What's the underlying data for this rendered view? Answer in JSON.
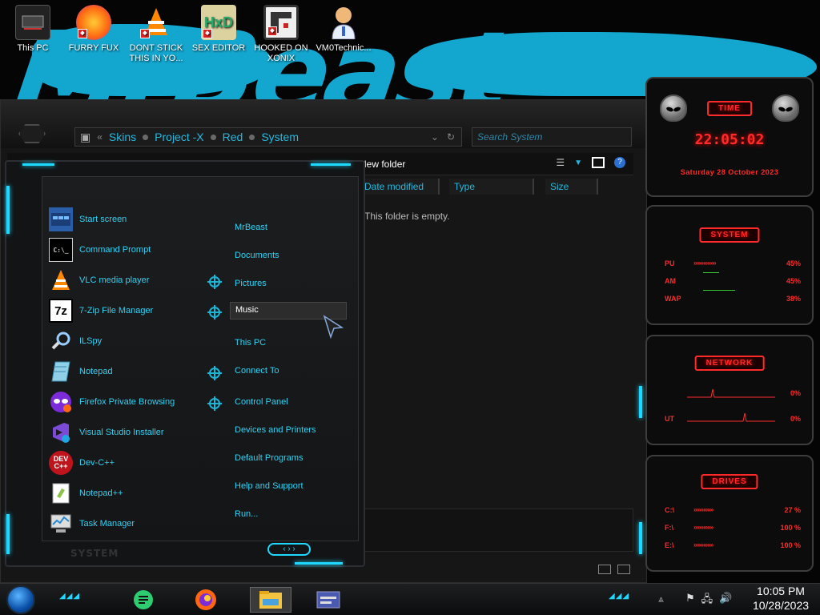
{
  "wallpaper": {
    "text": "MrBeast",
    "accent": "#13a6cf"
  },
  "desktop_icons": [
    {
      "label": "This PC",
      "icon": "this-pc-icon"
    },
    {
      "label": "FURRY FUX",
      "icon": "firefox-icon"
    },
    {
      "label": "DONT STICK THIS IN YO...",
      "icon": "vlc-icon"
    },
    {
      "label": "SEX EDITOR",
      "icon": "hxd-icon"
    },
    {
      "label": "HOOKED ON XONIX",
      "icon": "xonix-icon"
    },
    {
      "label": "VM0Technic...",
      "icon": "doctor-icon"
    }
  ],
  "explorer": {
    "breadcrumb": [
      "Skins",
      "Project -X",
      "Red",
      "System"
    ],
    "search_placeholder": "Search System",
    "toolbar_text": "New folder",
    "columns": [
      "Date modified",
      "Type",
      "Size"
    ],
    "empty_message": "This folder is empty."
  },
  "start_menu": {
    "programs": [
      {
        "label": "Start screen",
        "icon": "start-screen-icon",
        "pinned": false
      },
      {
        "label": "Command Prompt",
        "icon": "cmd-icon",
        "pinned": false
      },
      {
        "label": "VLC media player",
        "icon": "vlc-icon",
        "pinned": true
      },
      {
        "label": "7-Zip File Manager",
        "icon": "7zip-icon",
        "pinned": true
      },
      {
        "label": "ILSpy",
        "icon": "ilspy-icon",
        "pinned": false
      },
      {
        "label": "Notepad",
        "icon": "notepad-icon",
        "pinned": true
      },
      {
        "label": "Firefox Private Browsing",
        "icon": "firefox-private-icon",
        "pinned": true
      },
      {
        "label": "Visual Studio Installer",
        "icon": "vs-installer-icon",
        "pinned": false
      },
      {
        "label": "Dev-C++",
        "icon": "devcpp-icon",
        "pinned": false
      },
      {
        "label": "Notepad++",
        "icon": "notepadpp-icon",
        "pinned": false
      },
      {
        "label": "Task Manager",
        "icon": "task-manager-icon",
        "pinned": false
      }
    ],
    "places": [
      "MrBeast",
      "Documents",
      "Pictures",
      "Music",
      "This PC",
      "Connect To",
      "Control Panel",
      "Devices and Printers",
      "Default Programs",
      "Help and Support",
      "Run..."
    ],
    "active_place": "Music",
    "footer_label": "SYSTEM"
  },
  "gadgets": {
    "time": {
      "title": "TIME",
      "clock": "22:05:02",
      "date": "Saturday 28 October 2023"
    },
    "system": {
      "title": "SYSTEM",
      "rows": [
        {
          "label": "PU",
          "value": "45%"
        },
        {
          "label": "AM",
          "value": "45%"
        },
        {
          "label": "WAP",
          "value": "38%"
        }
      ]
    },
    "network": {
      "title": "NETWORK",
      "rows": [
        {
          "label": "",
          "value": "0%"
        },
        {
          "label": "UT",
          "value": "0%"
        }
      ]
    },
    "drives": {
      "title": "DRIVES",
      "rows": [
        {
          "label": "C:\\",
          "value": "27 %"
        },
        {
          "label": "F:\\",
          "value": "100 %"
        },
        {
          "label": "E:\\",
          "value": "100 %"
        }
      ]
    },
    "color": "#ff2a2a"
  },
  "taskbar": {
    "apps": [
      {
        "name": "green-app-icon",
        "active": false
      },
      {
        "name": "firefox-icon",
        "active": false
      },
      {
        "name": "file-explorer-icon",
        "active": true
      },
      {
        "name": "control-panel-icon",
        "active": false
      }
    ],
    "clock_time": "10:05 PM",
    "clock_date": "10/28/2023"
  }
}
